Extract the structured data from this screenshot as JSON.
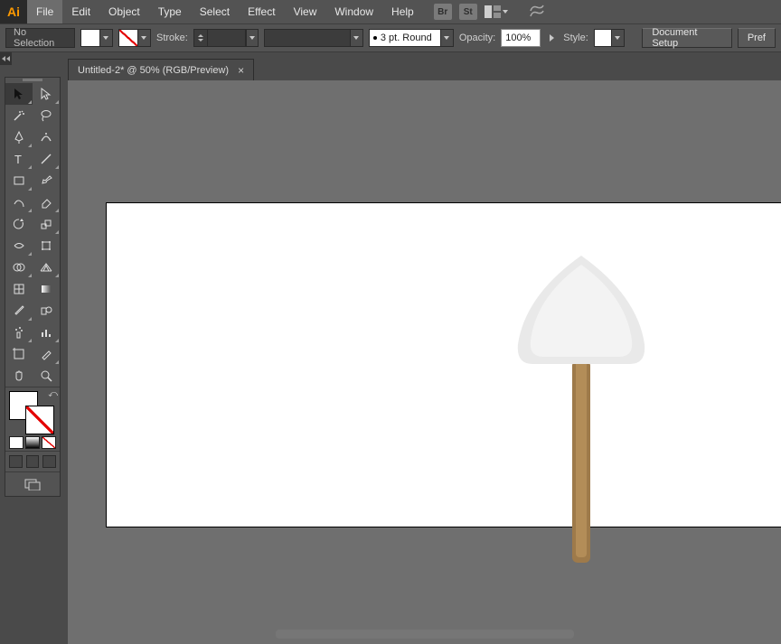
{
  "menubar": {
    "logo": "Ai",
    "items": [
      "File",
      "Edit",
      "Object",
      "Type",
      "Select",
      "Effect",
      "View",
      "Window",
      "Help"
    ],
    "active_index": 0,
    "bridge": "Br",
    "stock": "St"
  },
  "controlbar": {
    "selection_label": "No Selection",
    "stroke_label": "Stroke:",
    "stroke_weight": "",
    "brush_label": "3 pt. Round",
    "opacity_label": "Opacity:",
    "opacity_value": "100%",
    "style_label": "Style:",
    "doc_setup": "Document Setup",
    "prefs": "Pref"
  },
  "document": {
    "tab_title": "Untitled-2* @ 50% (RGB/Preview)"
  },
  "tools": {
    "left": [
      "selection-tool",
      "magic-wand-tool",
      "pen-tool",
      "type-tool",
      "rectangle-tool",
      "pencil-tool",
      "rotate-tool",
      "width-tool",
      "shape-builder-tool",
      "mesh-tool",
      "eyedropper-tool",
      "symbol-sprayer-tool",
      "artboard-tool",
      "hand-tool"
    ],
    "right": [
      "direct-selection-tool",
      "lasso-tool",
      "curvature-tool",
      "line-segment-tool",
      "paintbrush-tool",
      "eraser-tool",
      "scale-tool",
      "free-transform-tool",
      "perspective-grid-tool",
      "gradient-tool",
      "blend-tool",
      "column-graph-tool",
      "slice-tool",
      "zoom-tool"
    ]
  },
  "artwork": {
    "handle_color_outer": "#9e7a4a",
    "handle_color_inner": "#b38d58",
    "blade_outer": "#e9e9e9",
    "blade_inner": "#f3f3f3"
  }
}
